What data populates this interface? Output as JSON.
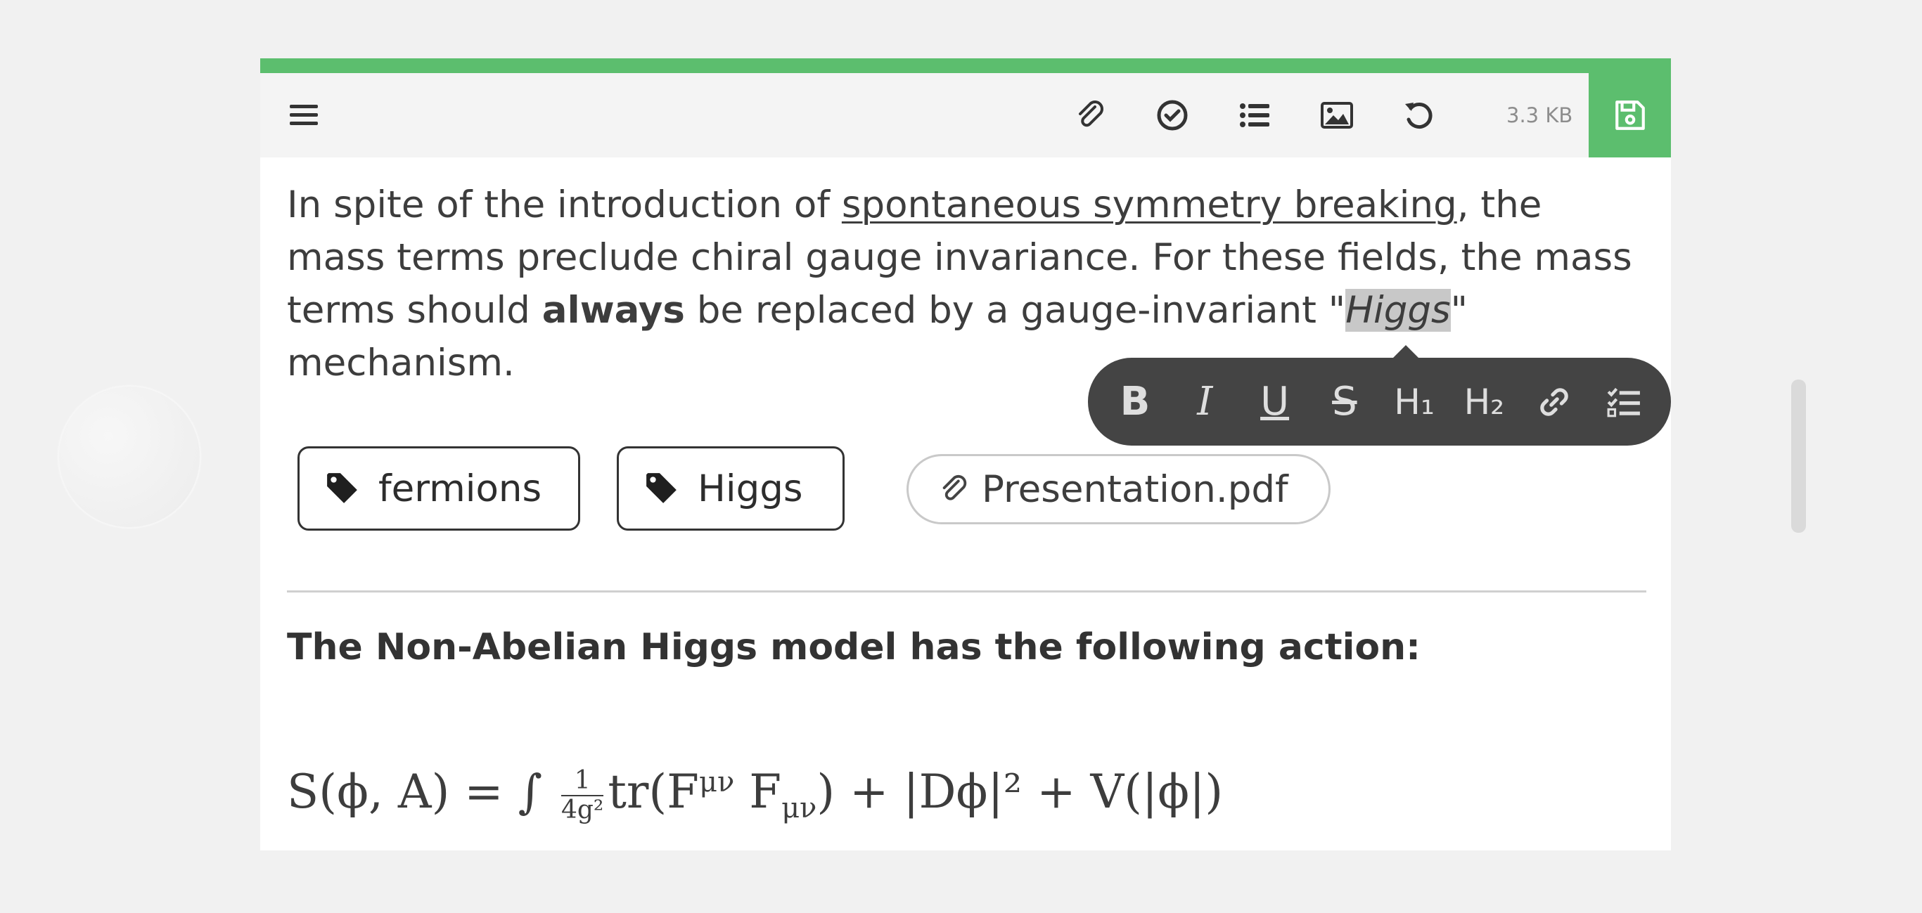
{
  "toolbar": {
    "menu_icon": "menu-icon",
    "attachment_icon": "paperclip-icon",
    "check_icon": "check-circle-icon",
    "list_icon": "list-icon",
    "image_icon": "image-icon",
    "undo_icon": "undo-icon",
    "file_size": "3.3 KB",
    "save_icon": "floppy-disk-icon"
  },
  "colors": {
    "accent": "#5cbe6e",
    "floating_toolbar_bg": "#444444",
    "highlight": "#c8c8c8"
  },
  "content": {
    "p1_a": "In spite of the introduction of ",
    "p1_link": "spontaneous symmetry breaking",
    "p1_b": ", the mass terms preclude chiral gauge invariance. For these fields, the mass terms should ",
    "p1_bold": "always",
    "p1_c": " be replaced by a gauge-invariant \"",
    "p1_highlight": "Higgs",
    "p1_d": "\" mechanism."
  },
  "format_toolbar": {
    "bold": "B",
    "italic": "I",
    "underline": "U",
    "strike": "S",
    "h1": "H₁",
    "h2": "H₂",
    "link_icon": "link-icon",
    "checklist_icon": "checklist-icon"
  },
  "tags": [
    {
      "label": "fermions",
      "icon": "tag-icon"
    },
    {
      "label": "Higgs",
      "icon": "tag-icon"
    }
  ],
  "attachment": {
    "label": "Presentation.pdf",
    "icon": "paperclip-icon"
  },
  "heading": "The Non-Abelian Higgs model has the following action:",
  "formula": {
    "lhs": "S(ϕ, A) = ∫ ",
    "frac_num": "1",
    "frac_den": "4g²",
    "rhs": "tr(F",
    "sup1": "μν",
    "mid": " F",
    "sub1": "μν",
    "tail": ") + |Dϕ|² + V(|ϕ|)"
  }
}
